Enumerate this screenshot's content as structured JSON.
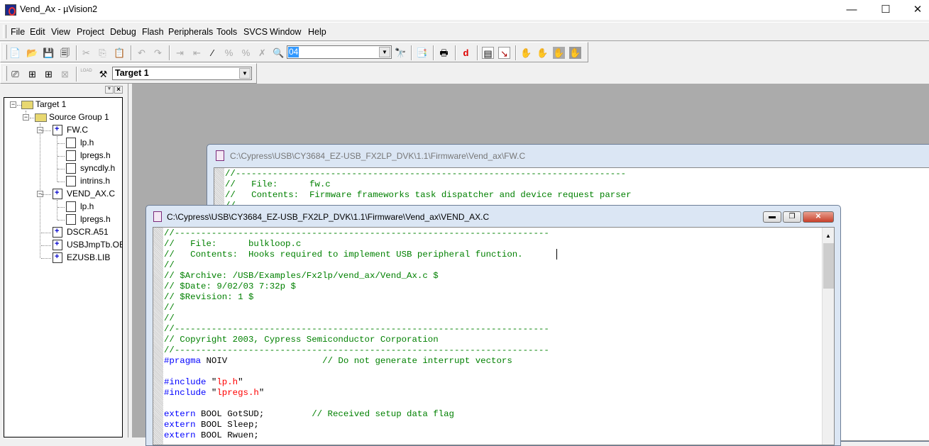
{
  "app": {
    "title": "Vend_Ax  - µVision2"
  },
  "window_controls": {
    "minimize": "—",
    "maximize": "☐",
    "close": "✕"
  },
  "menu": [
    "File",
    "Edit",
    "View",
    "Project",
    "Debug",
    "Flash",
    "Peripherals",
    "Tools",
    "SVCS",
    "Window",
    "Help"
  ],
  "toolbar": {
    "find_value": "04",
    "target_value": "Target 1",
    "load_label": "LOAD"
  },
  "tree": {
    "target": "Target 1",
    "group": "Source Group 1",
    "files": [
      {
        "name": "FW.C",
        "children": [
          "lp.h",
          "lpregs.h",
          "syncdly.h",
          "intrins.h"
        ]
      },
      {
        "name": "VEND_AX.C",
        "children": [
          "lp.h",
          "lpregs.h"
        ]
      },
      {
        "name": "DSCR.A51",
        "children": []
      },
      {
        "name": "USBJmpTb.OBJ",
        "children": []
      },
      {
        "name": "EZUSB.LIB",
        "children": []
      }
    ]
  },
  "fw_window": {
    "title": "C:\\Cypress\\USB\\CY3684_EZ-USB_FX2LP_DVK\\1.1\\Firmware\\Vend_ax\\FW.C",
    "lines": [
      [
        [
          "comment",
          "//--------------------------------------------------------------------------"
        ]
      ],
      [
        [
          "comment",
          "//   File:      fw.c"
        ]
      ],
      [
        [
          "comment",
          "//   Contents:  Firmware frameworks task dispatcher and device request parser"
        ]
      ],
      [
        [
          "comment",
          "//"
        ]
      ]
    ]
  },
  "vend_window": {
    "title": "C:\\Cypress\\USB\\CY3684_EZ-USB_FX2LP_DVK\\1.1\\Firmware\\Vend_ax\\VEND_AX.C",
    "lines": [
      [
        [
          "comment",
          "//-----------------------------------------------------------------------"
        ]
      ],
      [
        [
          "comment",
          "//   File:      bulkloop.c"
        ]
      ],
      [
        [
          "comment",
          "//   Contents:  Hooks required to implement USB peripheral function."
        ]
      ],
      [
        [
          "comment",
          "//"
        ]
      ],
      [
        [
          "comment",
          "// $Archive: /USB/Examples/Fx2lp/vend_ax/Vend_Ax.c $"
        ]
      ],
      [
        [
          "comment",
          "// $Date: 9/02/03 7:32p $"
        ]
      ],
      [
        [
          "comment",
          "// $Revision: 1 $"
        ]
      ],
      [
        [
          "comment",
          "//"
        ]
      ],
      [
        [
          "comment",
          "//"
        ]
      ],
      [
        [
          "comment",
          "//-----------------------------------------------------------------------"
        ]
      ],
      [
        [
          "comment",
          "// Copyright 2003, Cypress Semiconductor Corporation"
        ]
      ],
      [
        [
          "comment",
          "//-----------------------------------------------------------------------"
        ]
      ],
      [
        [
          "kw",
          "#pragma"
        ],
        [
          "text",
          " NOIV                  "
        ],
        [
          "comment",
          "// Do not generate interrupt vectors"
        ]
      ],
      [],
      [
        [
          "kw",
          "#include"
        ],
        [
          "text",
          " \""
        ],
        [
          "str",
          "lp.h"
        ],
        [
          "text",
          "\""
        ]
      ],
      [
        [
          "kw",
          "#include"
        ],
        [
          "text",
          " \""
        ],
        [
          "str",
          "lpregs.h"
        ],
        [
          "text",
          "\""
        ]
      ],
      [],
      [
        [
          "kw",
          "extern"
        ],
        [
          "text",
          " BOOL GotSUD;         "
        ],
        [
          "comment",
          "// Received setup data flag"
        ]
      ],
      [
        [
          "kw",
          "extern"
        ],
        [
          "text",
          " BOOL Sleep;"
        ]
      ],
      [
        [
          "kw",
          "extern"
        ],
        [
          "text",
          " BOOL Rwuen;"
        ]
      ]
    ]
  }
}
